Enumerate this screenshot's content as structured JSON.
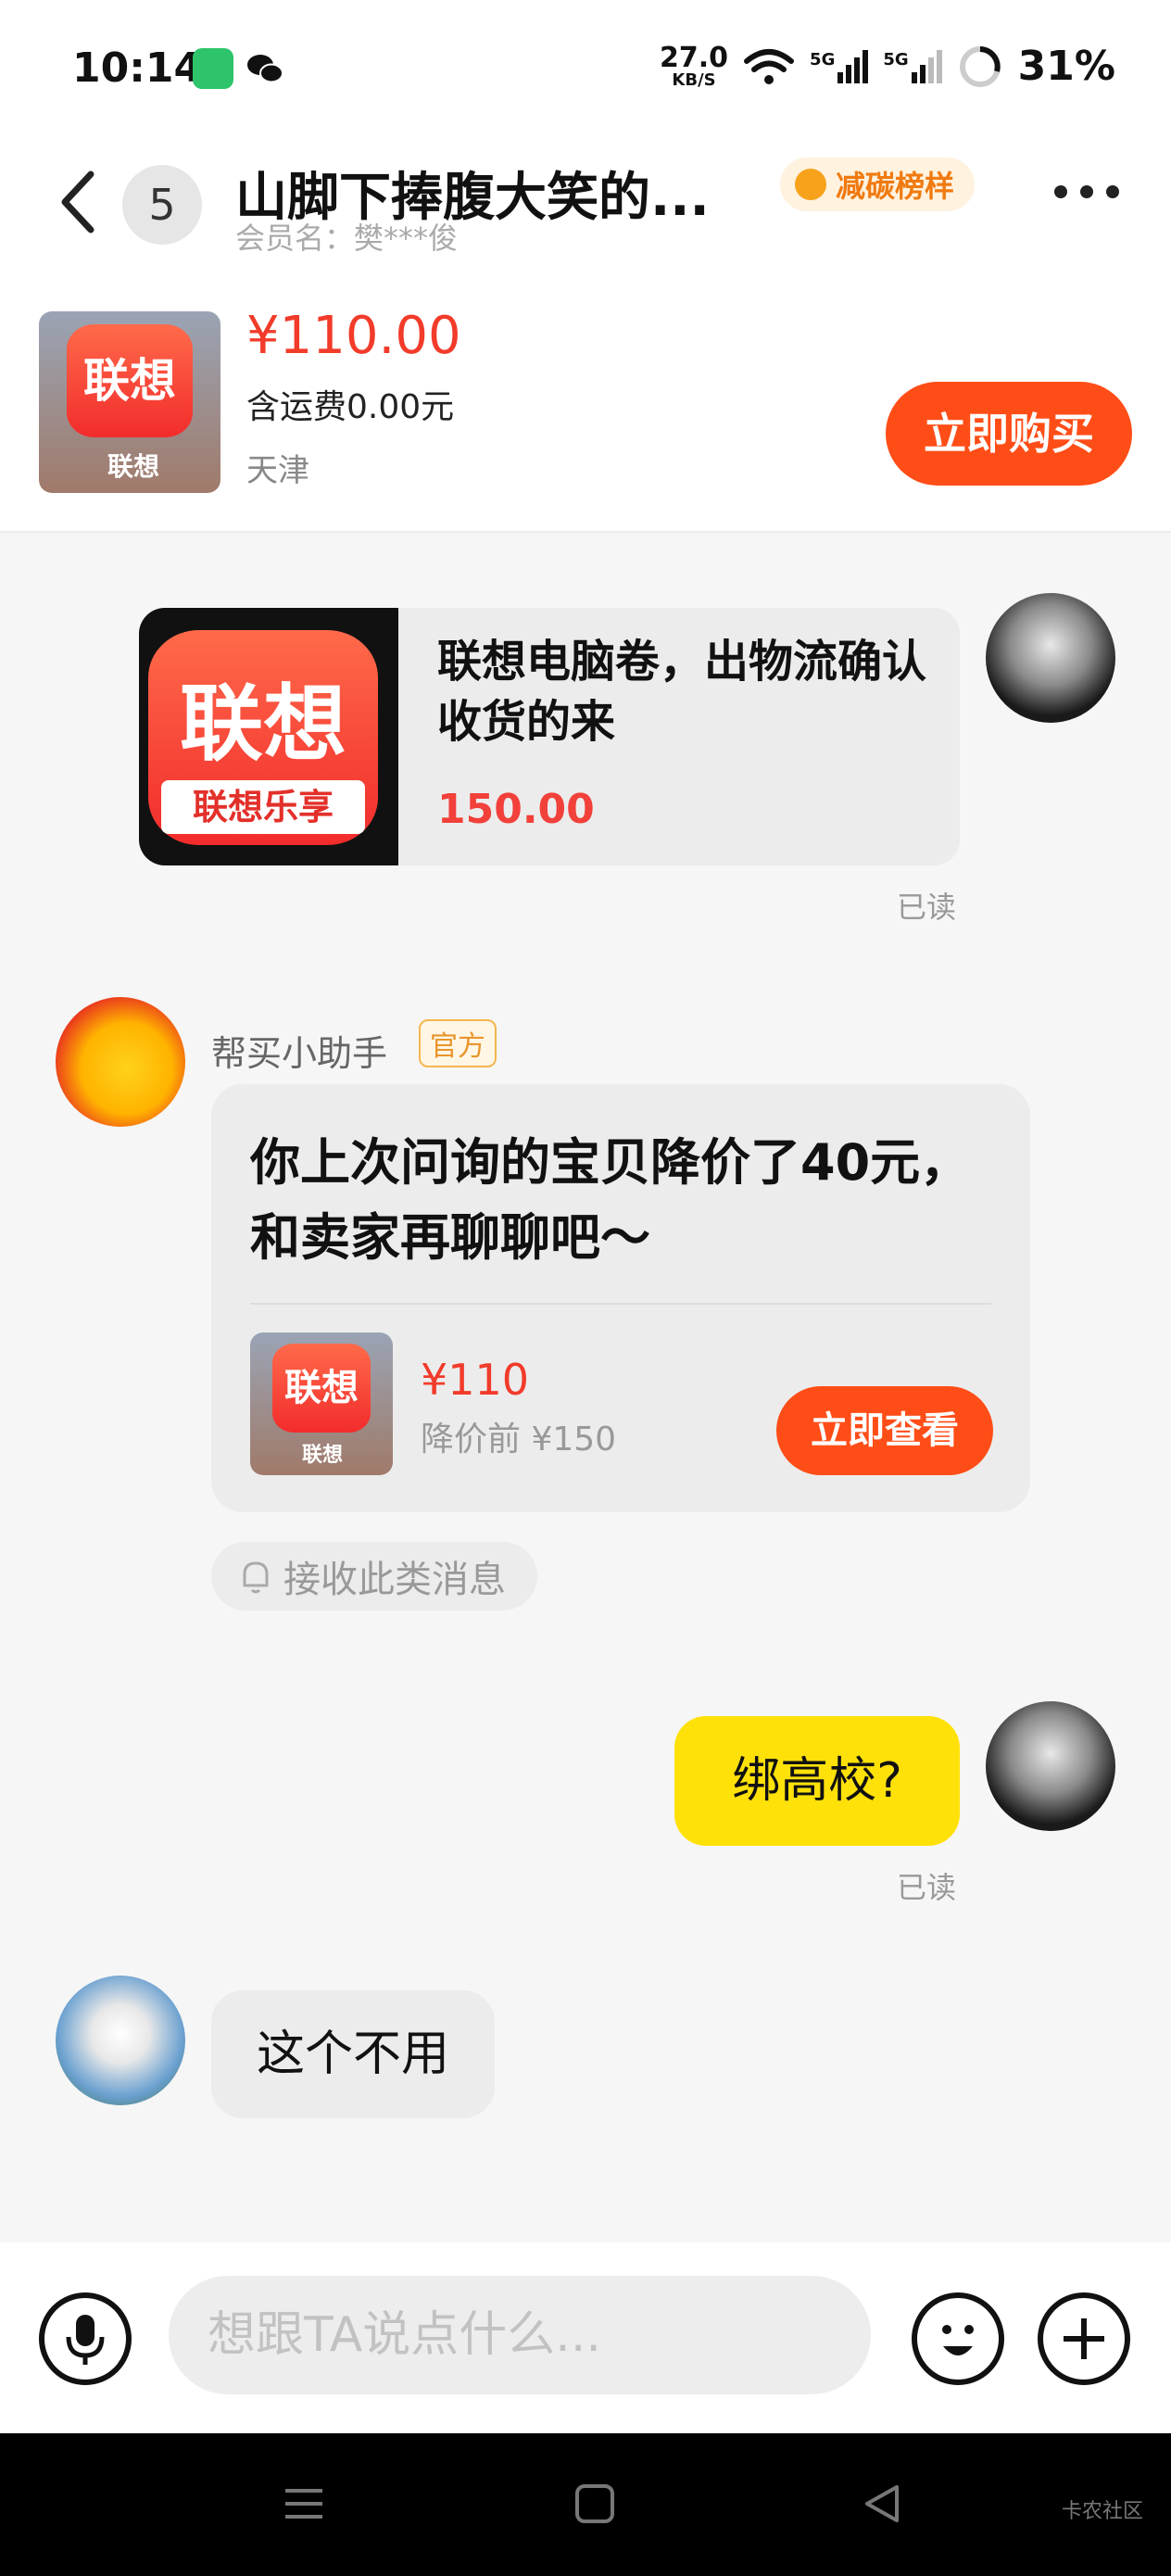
{
  "status_bar": {
    "time": "10:14",
    "net_speed_value": "27.0",
    "net_speed_unit": "KB/S",
    "signal1_label": "5G",
    "signal2_label": "5G",
    "battery": "31%"
  },
  "header": {
    "unread_count": "5",
    "title": "山脚下捧腹大笑的...",
    "member": "会员名：樊***俊",
    "badge": "减碳榜样"
  },
  "product": {
    "logo_text": "联想",
    "logo_caption": "联想",
    "price": "¥110.00",
    "shipping": "含运费0.00元",
    "location": "天津",
    "buy_label": "立即购买"
  },
  "messages": {
    "card1": {
      "logo_text": "联想",
      "logo_caption": "联想乐享",
      "text": "联想电脑卷，出物流确认收货的来",
      "price": "150.00",
      "read": "已读"
    },
    "helper": {
      "name": "帮买小助手",
      "official": "官方",
      "text": "你上次问询的宝贝降价了40元，和卖家再聊聊吧～",
      "logo_text": "联想",
      "logo_caption": "联想",
      "new_price": "¥110",
      "old_price": "降价前 ¥150",
      "view_label": "立即查看",
      "subscribe": "接收此类消息"
    },
    "my_question": {
      "text": "绑高校?",
      "read": "已读"
    },
    "reply": {
      "text": "这个不用"
    }
  },
  "input_bar": {
    "placeholder": "想跟TA说点什么..."
  },
  "watermark": "卡农社区",
  "colors": {
    "accent": "#ff4d17",
    "price_red": "#f23b2a",
    "bubble_yellow": "#ffe10a",
    "badge_orange": "#f07a10"
  }
}
